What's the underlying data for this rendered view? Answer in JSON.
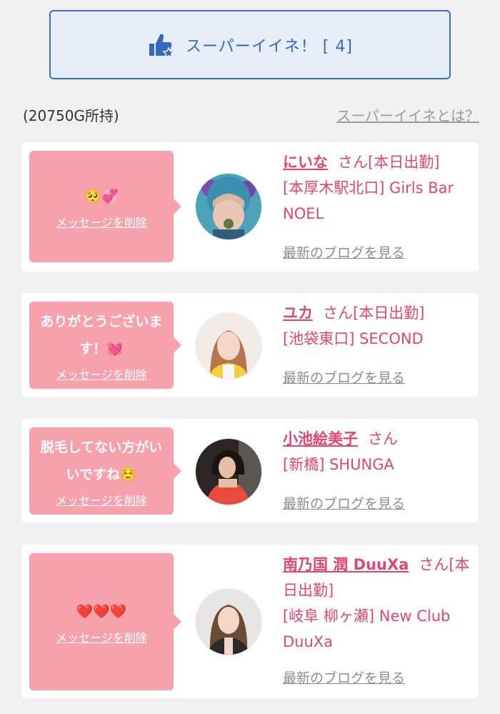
{
  "super_like": {
    "label": "スーパーイイネ！ [ 4]"
  },
  "balance": "(20750G所持)",
  "about_link": "スーパーイイネとは？",
  "delete_label": "メッセージを削除",
  "blog_label": "最新のブログを見る",
  "colors": {
    "accent": "#3569bd",
    "pink": "#e0466f",
    "bubble": "#f7a1ad"
  },
  "cards": [
    {
      "message": "🥺💞",
      "name": "にいな",
      "suffix": "さん[本日出勤]",
      "shop": "[本厚木駅北口] Girls Bar NOEL"
    },
    {
      "message": "ありがとうございます！💓",
      "name": "ユカ",
      "suffix": "さん[本日出勤]",
      "shop": "[池袋東口] SECOND"
    },
    {
      "message": "脱毛してない方がいいですね☺️",
      "name": "小池絵美子",
      "suffix": "さん",
      "shop": "[新橋] SHUNGA"
    },
    {
      "message": "❤️❤️❤️",
      "name": "南乃国 潤 DuuXa",
      "suffix": "さん[本日出勤]",
      "shop": "[岐阜 柳ヶ瀬] New Club DuuXa"
    }
  ]
}
